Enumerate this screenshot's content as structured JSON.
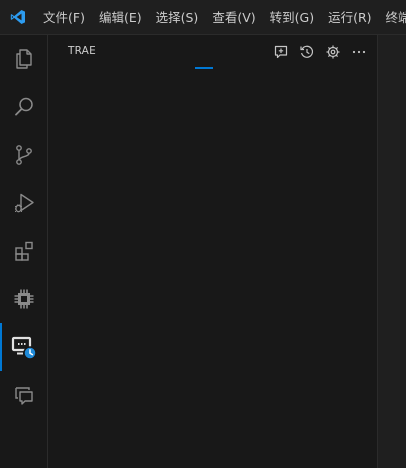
{
  "menu": {
    "items": [
      {
        "label": "文件(F)"
      },
      {
        "label": "编辑(E)"
      },
      {
        "label": "选择(S)"
      },
      {
        "label": "查看(V)"
      },
      {
        "label": "转到(G)"
      },
      {
        "label": "运行(R)"
      },
      {
        "label": "终端"
      }
    ]
  },
  "activity_bar": {
    "items": [
      {
        "icon": "explorer-icon"
      },
      {
        "icon": "search-icon"
      },
      {
        "icon": "source-control-icon"
      },
      {
        "icon": "run-debug-icon"
      },
      {
        "icon": "extensions-icon"
      },
      {
        "icon": "chip-icon"
      },
      {
        "icon": "remote-history-icon",
        "active": true
      },
      {
        "icon": "chat-icon"
      }
    ]
  },
  "side_panel": {
    "title": "TRAE",
    "actions": [
      "new-chat-icon",
      "history-icon",
      "settings-icon",
      "more-icon"
    ]
  },
  "colors": {
    "accent": "#0078d4",
    "background": "#181818",
    "titlebar": "#1f1f1f",
    "text": "#cccccc",
    "icon": "#c5c5c5"
  }
}
